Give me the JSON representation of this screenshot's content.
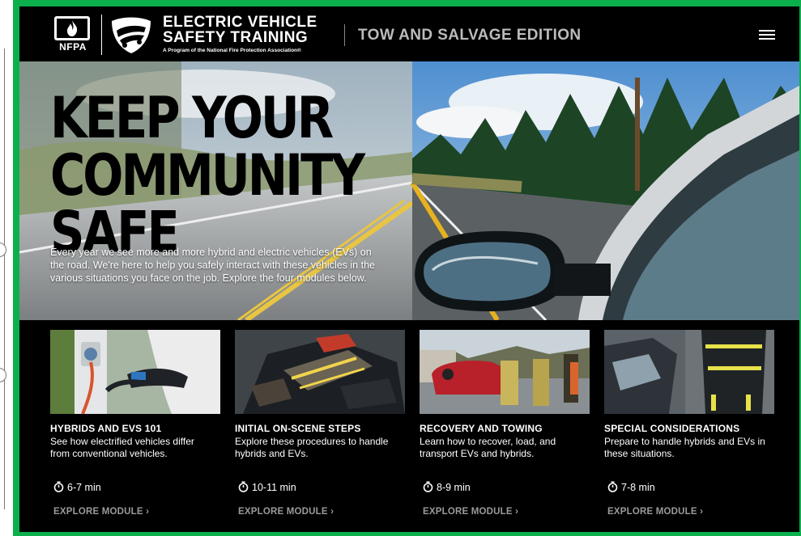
{
  "header": {
    "org_logo_text": "NFPA",
    "brand_line1": "ELECTRIC VEHICLE",
    "brand_line2": "SAFETY TRAINING",
    "brand_sub": "A Program of the National Fire Protection Association®",
    "edition": "TOW AND SALVAGE EDITION",
    "menu_icon": "hamburger-menu-icon"
  },
  "hero": {
    "title_line1": "KEEP YOUR",
    "title_line2": "COMMUNITY",
    "title_line3": "SAFE",
    "body": "Every year we see more and more hybrid and electric vehicles (EVs) on the road. We're here to help you safely interact with these vehicles in the various situations you face on the job. Explore the four modules below."
  },
  "modules": [
    {
      "title": "HYBRIDS AND EVS 101",
      "desc": "See how electrified vehicles differ from conventional vehicles.",
      "time": "6-7 min",
      "link": "EXPLORE MODULE ›",
      "thumb": "charging-plug"
    },
    {
      "title": "INITIAL ON-SCENE STEPS",
      "desc": "Explore these procedures to handle hybrids and EVs.",
      "time": "10-11 min",
      "link": "EXPLORE MODULE ›",
      "thumb": "firefighter-gear"
    },
    {
      "title": "RECOVERY AND TOWING",
      "desc": "Learn how to recover, load, and transport EVs and hybrids.",
      "time": "8-9 min",
      "link": "EXPLORE MODULE ›",
      "thumb": "overturned-car"
    },
    {
      "title": "SPECIAL CONSIDERATIONS",
      "desc": "Prepare to handle hybrids and EVs in these situations.",
      "time": "7-8 min",
      "link": "EXPLORE MODULE ›",
      "thumb": "crashed-car-firefighter"
    }
  ],
  "colors": {
    "frame": "#0bb04d",
    "background": "#000000",
    "link": "#9a9a9a",
    "edition": "#bbbbbb"
  }
}
